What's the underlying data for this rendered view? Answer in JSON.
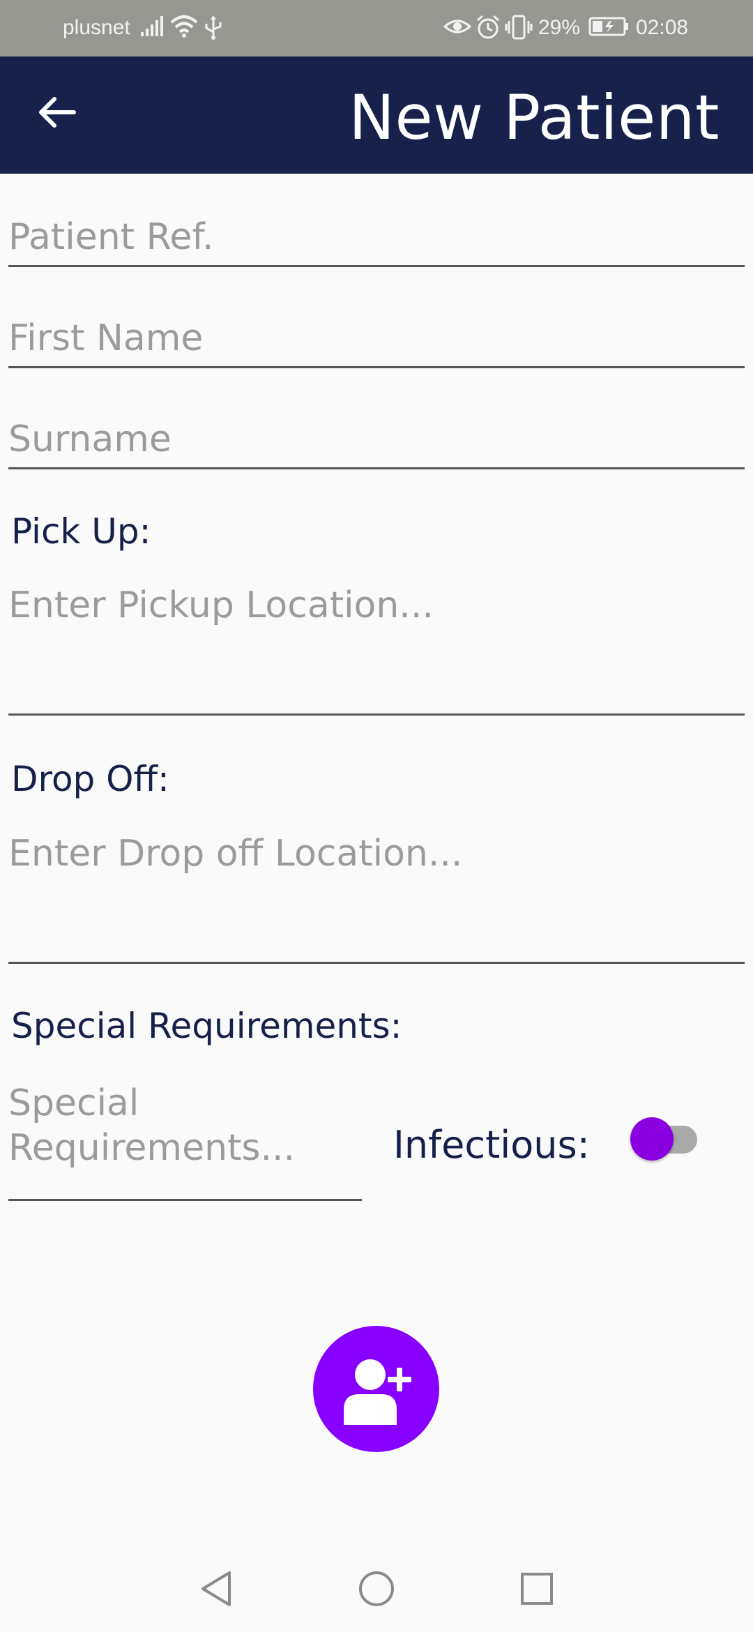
{
  "status_bar": {
    "carrier": "plusnet",
    "battery_percent": "29%",
    "time": "02:08",
    "icons": [
      "signal-icon",
      "wifi-icon",
      "usb-icon",
      "eye-icon",
      "alarm-icon",
      "vibrate-icon",
      "battery-charging-icon"
    ]
  },
  "app_bar": {
    "title": "New Patient",
    "back_icon": "arrow-left-icon",
    "background_color": "#17214c"
  },
  "form": {
    "patient_ref": {
      "placeholder": "Patient Ref.",
      "value": ""
    },
    "first_name": {
      "placeholder": "First Name",
      "value": ""
    },
    "surname": {
      "placeholder": "Surname",
      "value": ""
    },
    "pickup": {
      "label": "Pick Up:",
      "placeholder": "Enter Pickup Location...",
      "value": ""
    },
    "dropoff": {
      "label": "Drop Off:",
      "placeholder": "Enter Drop off Location...",
      "value": ""
    },
    "special_requirements": {
      "label": "Special Requirements:",
      "placeholder": "Special Requirements...",
      "value": ""
    },
    "infectious": {
      "label": "Infectious:",
      "enabled": false
    }
  },
  "fab": {
    "icon": "add-user-icon",
    "color": "#8800ff"
  },
  "nav_bar": {
    "icons": [
      "back-triangle-icon",
      "home-circle-icon",
      "recents-square-icon"
    ]
  },
  "accent_color": "#8a00e0"
}
